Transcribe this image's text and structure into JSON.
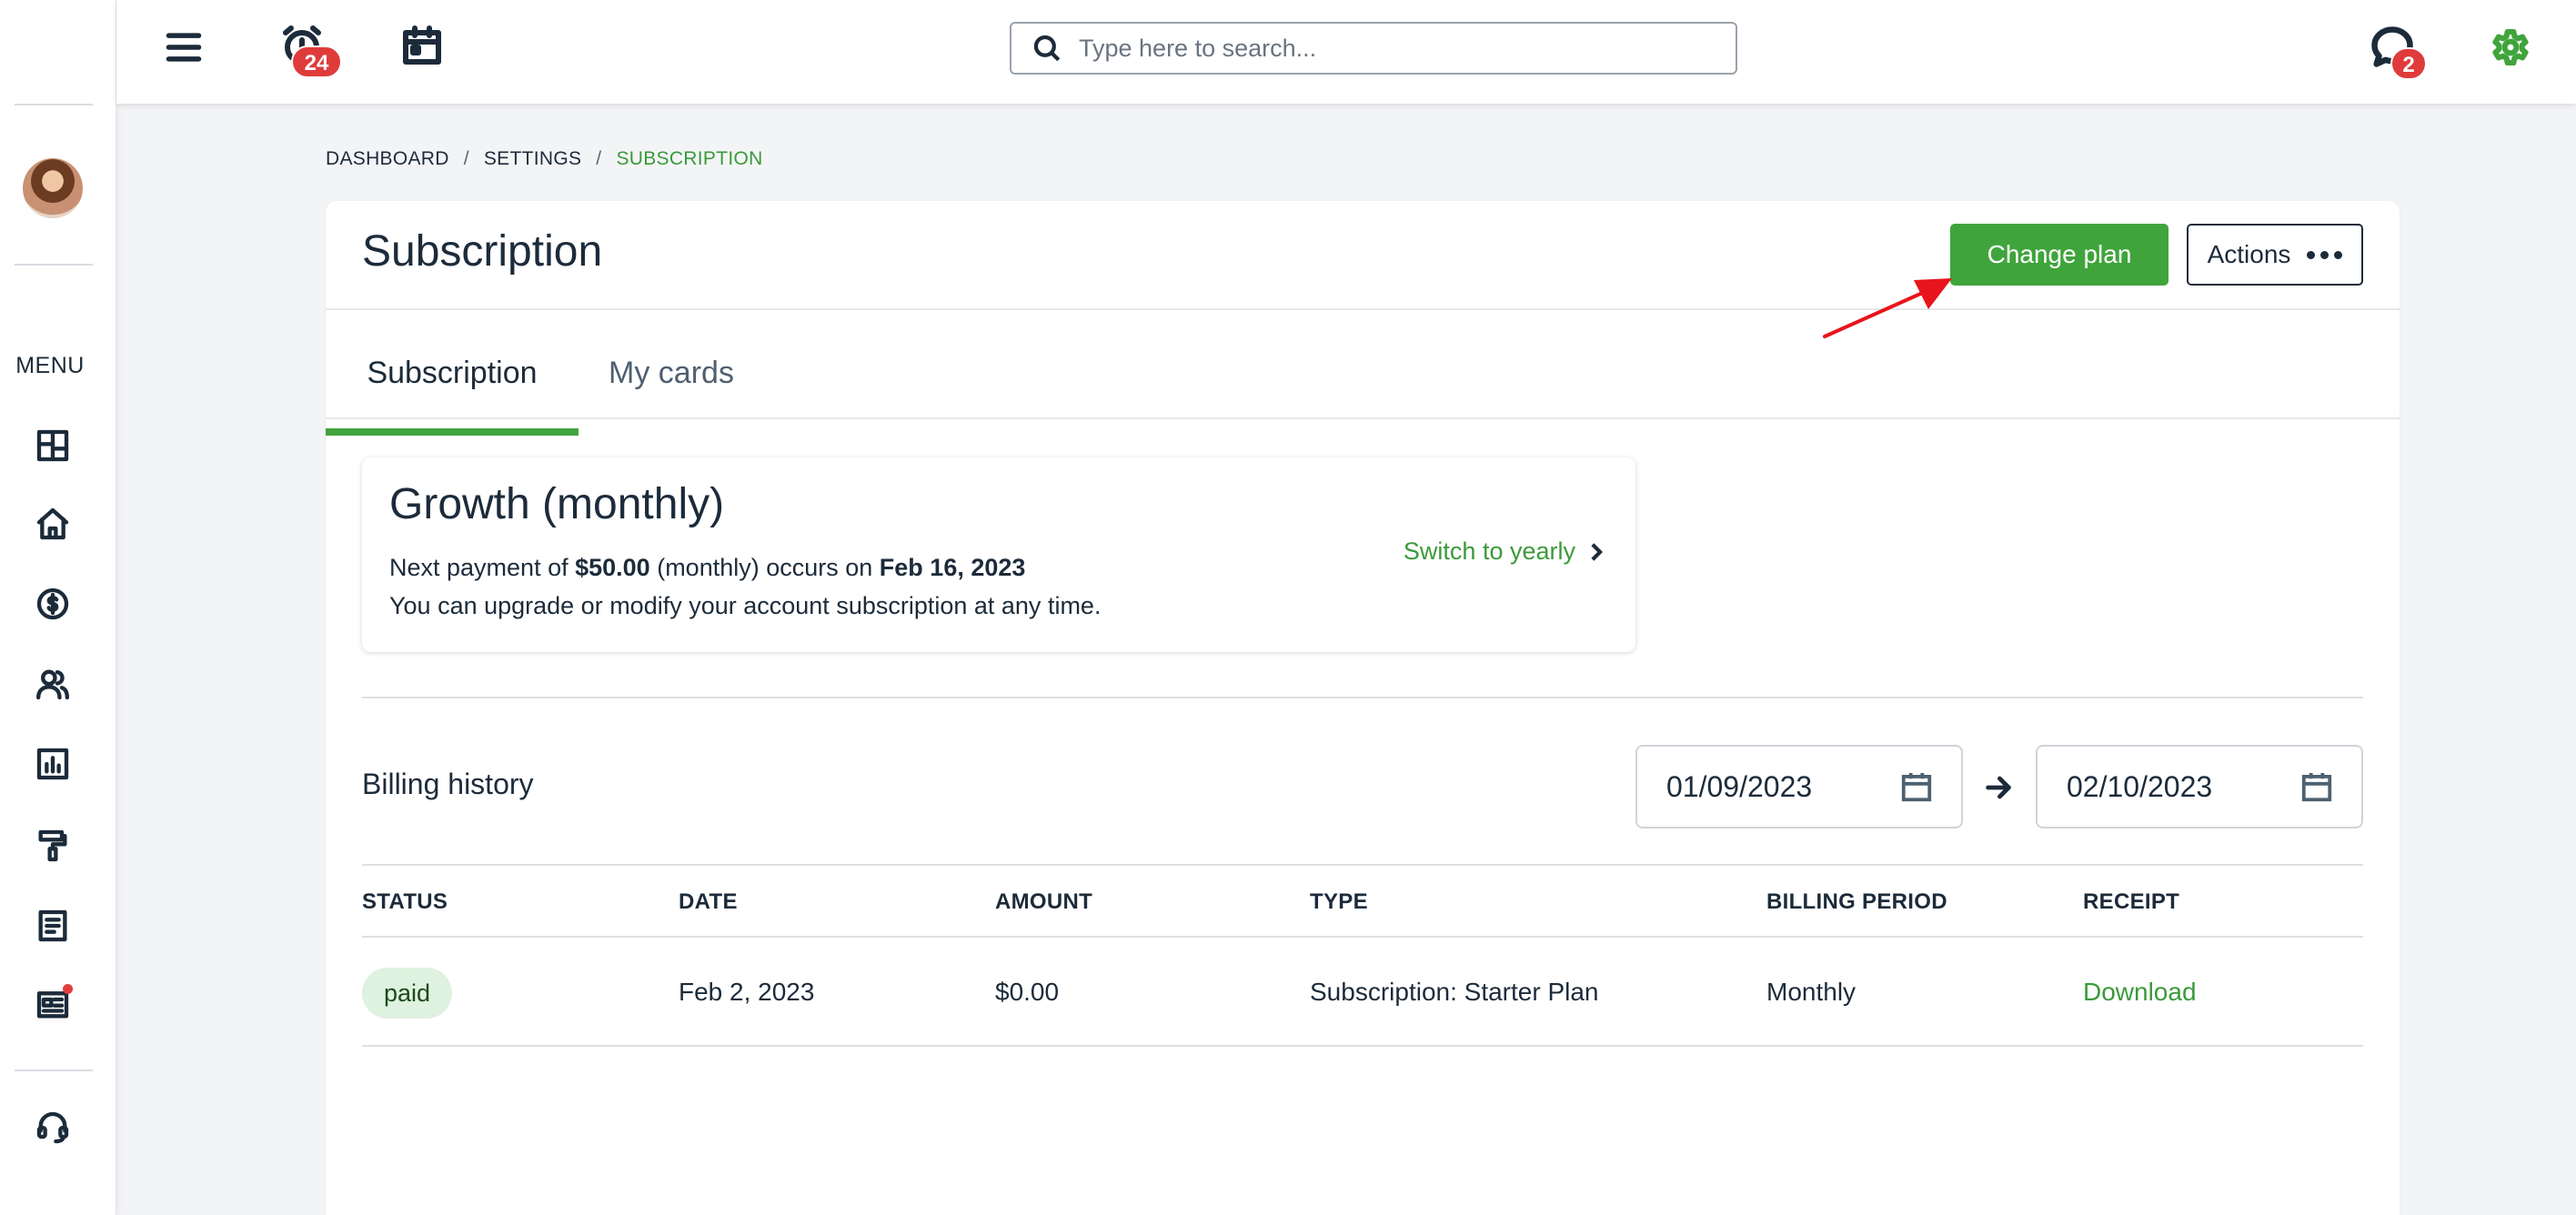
{
  "sidebar": {
    "menu_label": "MENU",
    "items": [
      {
        "name": "dashboard",
        "icon": "layout-grid-icon"
      },
      {
        "name": "home",
        "icon": "home-icon"
      },
      {
        "name": "payments",
        "icon": "dollar-circle-icon"
      },
      {
        "name": "users",
        "icon": "users-icon"
      },
      {
        "name": "reports",
        "icon": "bar-chart-icon"
      },
      {
        "name": "customize",
        "icon": "paint-roller-icon"
      },
      {
        "name": "documents",
        "icon": "document-icon"
      },
      {
        "name": "news",
        "icon": "newspaper-icon",
        "has_notification": true
      }
    ],
    "support_icon": "headset-icon"
  },
  "topbar": {
    "menu_icon": "hamburger-icon",
    "alarm_icon": "alarm-clock-icon",
    "alarm_count": "24",
    "calendar_icon": "calendar-icon",
    "search_placeholder": "Type here to search...",
    "chat_icon": "chat-bubble-icon",
    "chat_count": "2",
    "settings_icon": "gear-icon",
    "settings_color": "#40a43c"
  },
  "breadcrumb": {
    "items": [
      "DASHBOARD",
      "SETTINGS",
      "SUBSCRIPTION"
    ],
    "separator": "/"
  },
  "page": {
    "title": "Subscription",
    "change_plan_label": "Change plan",
    "actions_label": "Actions",
    "tabs": [
      {
        "label": "Subscription",
        "active": true
      },
      {
        "label": "My cards",
        "active": false
      }
    ]
  },
  "plan": {
    "name": "Growth (monthly)",
    "next_payment_prefix": "Next payment of ",
    "amount": "$50.00",
    "period_text": " (monthly) occurs on ",
    "date": "Feb 16, 2023",
    "description": "You can upgrade or modify your account subscription at any time.",
    "switch_label": "Switch to yearly"
  },
  "billing": {
    "title": "Billing history",
    "date_from": "01/09/2023",
    "date_to": "02/10/2023",
    "columns": [
      "STATUS",
      "DATE",
      "AMOUNT",
      "TYPE",
      "BILLING PERIOD",
      "RECEIPT"
    ],
    "rows": [
      {
        "status": "paid",
        "date": "Feb 2, 2023",
        "amount": "$0.00",
        "type": "Subscription: Starter Plan",
        "billing_period": "Monthly",
        "receipt": "Download"
      }
    ]
  },
  "colors": {
    "accent": "#40a43c",
    "badge": "#e03b3b",
    "annotation_arrow": "#e8141b"
  }
}
